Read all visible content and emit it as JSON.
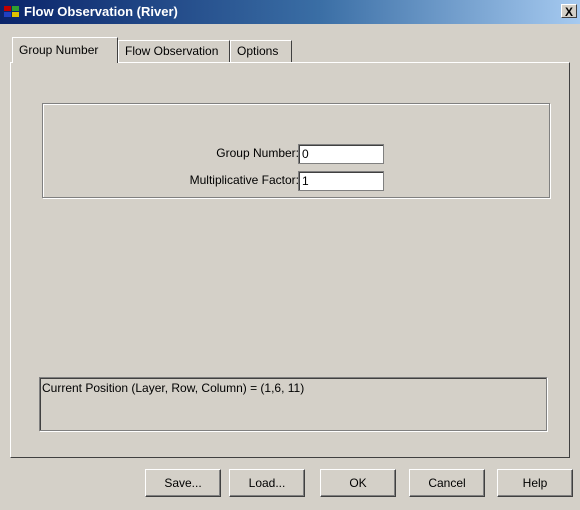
{
  "window": {
    "title": "Flow Observation (River)",
    "close_label": "X",
    "icon": "app-icon"
  },
  "tabs": [
    {
      "label": "Group Number",
      "active": true
    },
    {
      "label": "Flow Observation",
      "active": false
    },
    {
      "label": "Options",
      "active": false
    }
  ],
  "group_number_tab": {
    "group_number_label": "Group Number:",
    "group_number_value": "0",
    "multiplicative_factor_label": "Multiplicative Factor:",
    "multiplicative_factor_value": "1"
  },
  "status": {
    "current_position": "Current Position (Layer, Row, Column) = (1,6, 11)"
  },
  "buttons": {
    "save": "Save...",
    "load": "Load...",
    "ok": "OK",
    "cancel": "Cancel",
    "help": "Help"
  },
  "colors": {
    "face": "#d4d0c8",
    "titlebar_start": "#0a246a",
    "titlebar_end": "#a6caf0"
  }
}
